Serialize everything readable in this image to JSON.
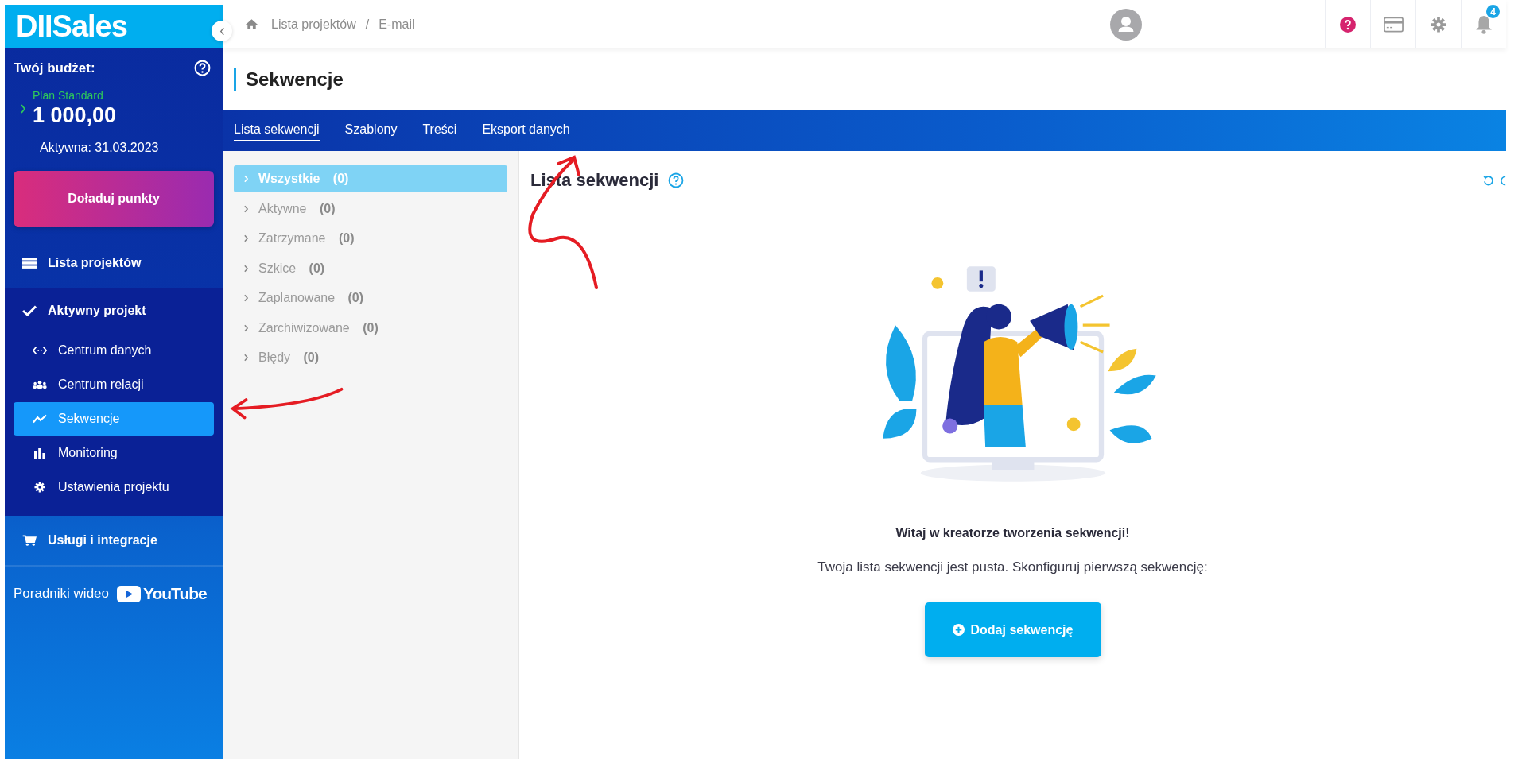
{
  "logo": "DIISales",
  "budget": {
    "title": "Twój budżet:",
    "plan": "Plan Standard",
    "amount": "1 000,00",
    "active_until": "Aktywna: 31.03.2023",
    "topup_button": "Doładuj punkty"
  },
  "nav": [
    {
      "label": "Lista projektów",
      "kind": "list",
      "selected": false
    },
    {
      "label": "Aktywny projekt",
      "kind": "check",
      "selected": false,
      "children": [
        {
          "label": "Centrum danych",
          "kind": "code",
          "selected": false
        },
        {
          "label": "Centrum relacji",
          "kind": "people",
          "selected": false
        },
        {
          "label": "Sekwencje",
          "kind": "trend",
          "selected": true
        },
        {
          "label": "Monitoring",
          "kind": "bars",
          "selected": false
        },
        {
          "label": "Ustawienia projektu",
          "kind": "gear",
          "selected": false
        }
      ]
    },
    {
      "label": "Usługi i integracje",
      "kind": "cart",
      "selected": false
    }
  ],
  "video_guides": {
    "label": "Poradniki wideo",
    "logo": "YouTube"
  },
  "breadcrumb": {
    "items": [
      "Lista projektów",
      "E-mail"
    ],
    "separator": "/"
  },
  "notifications_count": "4",
  "page_title": "Sekwencje",
  "tabs": [
    {
      "label": "Lista sekwencji",
      "selected": true
    },
    {
      "label": "Szablony",
      "selected": false
    },
    {
      "label": "Treści",
      "selected": false
    },
    {
      "label": "Eksport danych",
      "selected": false
    }
  ],
  "filters": [
    {
      "label": "Wszystkie",
      "count": "(0)",
      "selected": true
    },
    {
      "label": "Aktywne",
      "count": "(0)",
      "selected": false
    },
    {
      "label": "Zatrzymane",
      "count": "(0)",
      "selected": false
    },
    {
      "label": "Szkice",
      "count": "(0)",
      "selected": false
    },
    {
      "label": "Zaplanowane",
      "count": "(0)",
      "selected": false
    },
    {
      "label": "Zarchiwizowane",
      "count": "(0)",
      "selected": false
    },
    {
      "label": "Błędy",
      "count": "(0)",
      "selected": false
    }
  ],
  "content": {
    "title": "Lista sekwencji",
    "welcome": "Witaj w kreatorze tworzenia sekwencji!",
    "message": "Twoja lista sekwencji jest pusta. Skonfiguruj pierwszą sekwencję:",
    "add_button": "Dodaj sekwencję"
  }
}
